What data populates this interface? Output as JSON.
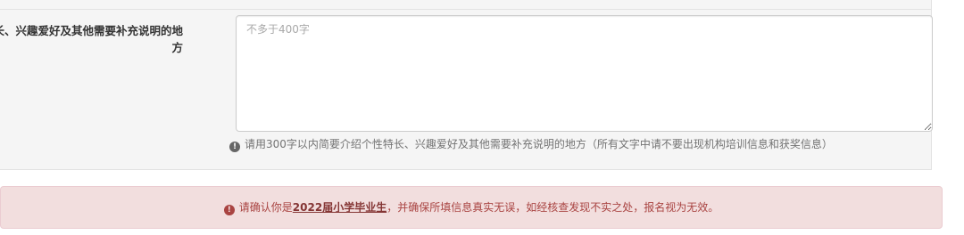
{
  "form": {
    "field_label": "个性特长、兴趣爱好及其他需要补充说明的地方",
    "textarea_placeholder": "不多于400字",
    "textarea_value": "",
    "help_icon": "info-circle-icon",
    "help_text": "请用300字以内简要介绍个性特长、兴趣爱好及其他需要补充说明的地方（所有文字中请不要出现机构培训信息和获奖信息）"
  },
  "alert": {
    "icon": "info-circle-icon",
    "text_before": "请确认你是",
    "highlight": "2022届小学毕业生",
    "text_after": "，并确保所填信息真实无误，如经核查发现不实之处，报名视为无效。",
    "colors": {
      "background": "#f2dede",
      "border": "#ebccd1",
      "text": "#a94442"
    }
  }
}
